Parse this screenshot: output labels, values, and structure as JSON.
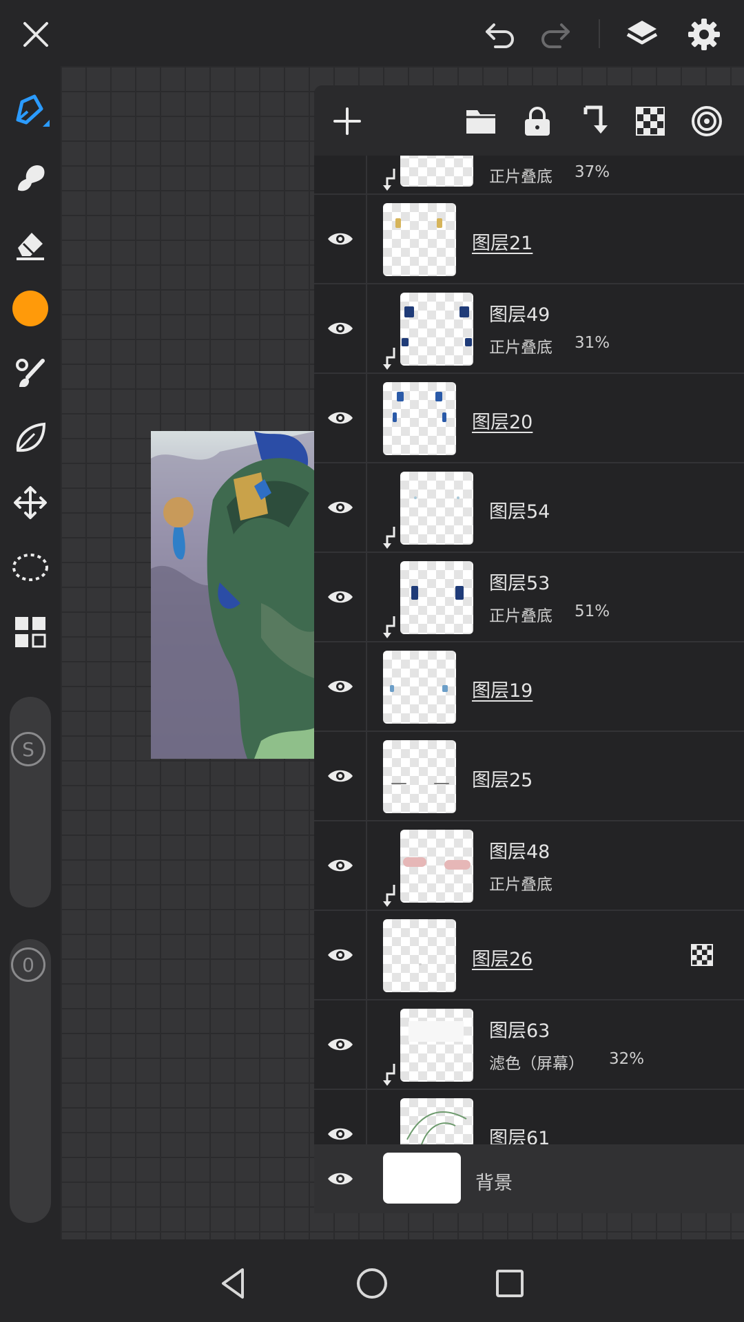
{
  "topbar": {
    "close_icon": "close-icon",
    "undo_icon": "undo-icon",
    "redo_icon": "redo-icon",
    "layers_icon": "layers-icon",
    "settings_icon": "gear-icon"
  },
  "sidebar": {
    "tools": [
      "pen-tool-icon",
      "smudge-tool-icon",
      "eraser-icon",
      "color-swatch",
      "brush-settings-icon",
      "leaf-icon",
      "move-icon",
      "lasso-icon",
      "grid-icon"
    ],
    "active_color": "#ff9a0a",
    "accent": "#2b9bff",
    "size_label": "S",
    "opacity_label": "0"
  },
  "layer_panel": {
    "toolbar": [
      "add-layer-icon",
      "folder-icon",
      "lock-icon",
      "clip-icon",
      "transparency-icon",
      "target-icon"
    ],
    "layers": [
      {
        "name": "",
        "blend": "正片叠底",
        "opacity": "37%",
        "clipped": true
      },
      {
        "name": "图层21",
        "blend": "",
        "opacity": "",
        "clipped": false,
        "underline": true
      },
      {
        "name": "图层49",
        "blend": "正片叠底",
        "opacity": "31%",
        "clipped": true
      },
      {
        "name": "图层20",
        "blend": "",
        "opacity": "",
        "clipped": false,
        "underline": true
      },
      {
        "name": "图层54",
        "blend": "",
        "opacity": "",
        "clipped": true
      },
      {
        "name": "图层53",
        "blend": "正片叠底",
        "opacity": "51%",
        "clipped": true
      },
      {
        "name": "图层19",
        "blend": "",
        "opacity": "",
        "clipped": false,
        "underline": true
      },
      {
        "name": "图层25",
        "blend": "",
        "opacity": "",
        "clipped": false
      },
      {
        "name": "图层48",
        "blend": "正片叠底",
        "opacity": "",
        "clipped": true
      },
      {
        "name": "图层26",
        "blend": "",
        "opacity": "",
        "clipped": false,
        "underline": true,
        "alpha_lock": true
      },
      {
        "name": "图层63",
        "blend": "滤色（屏幕）",
        "opacity": "32%",
        "clipped": true
      },
      {
        "name": "图层61",
        "blend": "",
        "opacity": "",
        "clipped": true
      }
    ],
    "background_layer": {
      "name": "背景"
    }
  },
  "navbar": {
    "back": "back-icon",
    "home": "home-icon",
    "recents": "recents-icon"
  }
}
